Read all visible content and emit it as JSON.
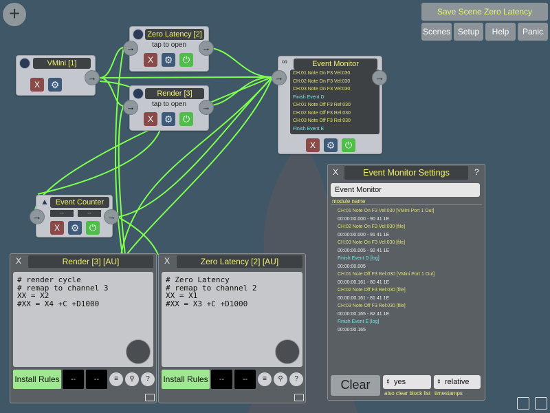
{
  "toolbar": {
    "add_label": "+",
    "save_scene_label": "Save Scene Zero Latency",
    "scenes_label": "Scenes",
    "setup_label": "Setup",
    "help_label": "Help",
    "panic_label": "Panic"
  },
  "nodes": {
    "vmini": {
      "title": "VMini [1]"
    },
    "zero_latency": {
      "title": "Zero Latency [2]",
      "hint": "tap to open"
    },
    "render": {
      "title": "Render [3]",
      "hint": "tap to open"
    },
    "event_monitor": {
      "title": "Event Monitor",
      "log": [
        {
          "text": "CH:01 Note On F3 Vel:030",
          "kind": "note"
        },
        {
          "text": "CH:02 Note On F3 Vel:030",
          "kind": "note"
        },
        {
          "text": "CH:03 Note On F3 Vel:030",
          "kind": "note"
        },
        {
          "text": "Finish Event D",
          "kind": "finish"
        },
        {
          "text": "CH:01 Note Off F3 Rel:030",
          "kind": "note"
        },
        {
          "text": "CH:02 Note Off F3 Rel:030",
          "kind": "note"
        },
        {
          "text": "CH:03 Note Off F3 Rel:030",
          "kind": "note"
        },
        {
          "text": "Finish Event E",
          "kind": "finish"
        }
      ]
    },
    "event_counter": {
      "title": "Event Counter",
      "field1": "--",
      "field2": "--"
    }
  },
  "buttons": {
    "close": "X",
    "port_arrow": "→",
    "power": "⏻",
    "gear": "⚙"
  },
  "render_panel": {
    "title": "Render [3] [AU]",
    "code": "# render cycle\n# remap to channel 3\nXX = X2\n#XX = X4 +C +D1000",
    "install_label": "Install Rules",
    "field1": "--",
    "field2": "--"
  },
  "zero_panel": {
    "title": "Zero Latency [2] [AU]",
    "code": "# Zero Latency\n# remap to channel 2\nXX = X1\n#XX = X3 +C +D1000",
    "install_label": "Install Rules",
    "field1": "--",
    "field2": "--"
  },
  "settings": {
    "title": "Event Monitor Settings",
    "help_label": "?",
    "module_name_value": "Event Monitor",
    "module_name_caption": "module name",
    "entries": [
      {
        "text": "CH:01 Note On F3 Vel:030 [VMini Port 1 Out]",
        "kind": "note",
        "ts": "00:00:00.000 - 90 41 1E"
      },
      {
        "text": "CH:02 Note On F3 Vel:030 [file]",
        "kind": "note",
        "ts": "00:00:00.000 - 91 41 1E"
      },
      {
        "text": "CH:03 Note On F3 Vel:030 [file]",
        "kind": "note",
        "ts": "00:00:00.005 - 92 41 1E"
      },
      {
        "text": "Finish Event D [log]",
        "kind": "finish",
        "ts": "00:00:00.005"
      },
      {
        "text": "CH:01 Note Off F3 Rel:030 [VMini Port 1 Out]",
        "kind": "note",
        "ts": "00:00:00.161 - 80 41 1E"
      },
      {
        "text": "CH:02 Note Off F3 Rel:030 [file]",
        "kind": "note",
        "ts": "00:00:00.161 - 81 41 1E"
      },
      {
        "text": "CH:03 Note Off F3 Rel:030 [file]",
        "kind": "note",
        "ts": "00:00:00.165 - 82 41 1E"
      },
      {
        "text": "Finish Event E [log]",
        "kind": "finish",
        "ts": "00:00:00.165"
      }
    ],
    "clear_label": "Clear",
    "also_clear_value": "yes",
    "also_clear_caption": "also clear block list",
    "timestamps_value": "relative",
    "timestamps_caption": "timestamps"
  },
  "colors": {
    "background": "#3f5766",
    "wire": "#7dff4f",
    "title_text": "#f0f070",
    "finish_text": "#7fe0e4"
  }
}
